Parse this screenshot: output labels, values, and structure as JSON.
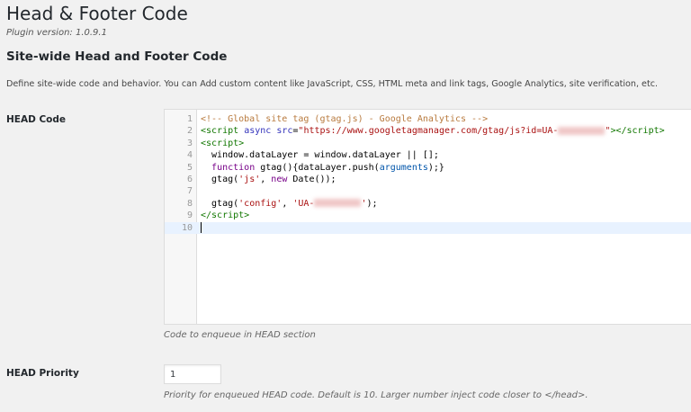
{
  "page": {
    "title": "Head & Footer Code",
    "version": "Plugin version: 1.0.9.1",
    "section_title": "Site-wide Head and Footer Code",
    "description": "Define site-wide code and behavior. You can Add custom content like JavaScript, CSS, HTML meta and link tags, Google Analytics, site verification, etc."
  },
  "head_code": {
    "label": "HEAD Code",
    "help": "Code to enqueue in HEAD section",
    "active_line": 10,
    "lines": [
      {
        "n": "1",
        "tokens": [
          [
            "<!-- Global site tag (gtag.js) - Google Analytics -->",
            "comment"
          ]
        ]
      },
      {
        "n": "2",
        "tokens": [
          [
            "<script",
            "tag"
          ],
          [
            " ",
            ""
          ],
          [
            "async",
            "attr"
          ],
          [
            " ",
            ""
          ],
          [
            "src",
            "attr"
          ],
          [
            "=",
            ""
          ],
          [
            "\"https://www.googletagmanager.com/gtag/js?id=UA-",
            "string"
          ],
          [
            "",
            "redacted"
          ],
          [
            "\"",
            "string"
          ],
          [
            "></script>",
            "tag"
          ]
        ]
      },
      {
        "n": "3",
        "tokens": [
          [
            "<script>",
            "tag"
          ]
        ]
      },
      {
        "n": "4",
        "tokens": [
          [
            "  window.dataLayer = window.dataLayer || [];",
            ""
          ]
        ]
      },
      {
        "n": "5",
        "tokens": [
          [
            "  ",
            ""
          ],
          [
            "function",
            "keyword"
          ],
          [
            " gtag(){dataLayer.push(",
            ""
          ],
          [
            "arguments",
            "var"
          ],
          [
            ");}",
            ""
          ]
        ]
      },
      {
        "n": "6",
        "tokens": [
          [
            "  gtag(",
            ""
          ],
          [
            "'js'",
            "string"
          ],
          [
            ", ",
            ""
          ],
          [
            "new",
            "keyword"
          ],
          [
            " Date());",
            ""
          ]
        ]
      },
      {
        "n": "7",
        "tokens": []
      },
      {
        "n": "8",
        "tokens": [
          [
            "  gtag(",
            ""
          ],
          [
            "'config'",
            "string"
          ],
          [
            ", ",
            ""
          ],
          [
            "'UA-",
            "string"
          ],
          [
            "",
            "redacted"
          ],
          [
            "'",
            "string"
          ],
          [
            ");",
            ""
          ]
        ]
      },
      {
        "n": "9",
        "tokens": [
          [
            "</script>",
            "tag"
          ]
        ]
      },
      {
        "n": "10",
        "tokens": []
      }
    ]
  },
  "head_priority": {
    "label": "HEAD Priority",
    "value": "1",
    "help": "Priority for enqueued HEAD code. Default is 10. Larger number inject code closer to </head>."
  }
}
